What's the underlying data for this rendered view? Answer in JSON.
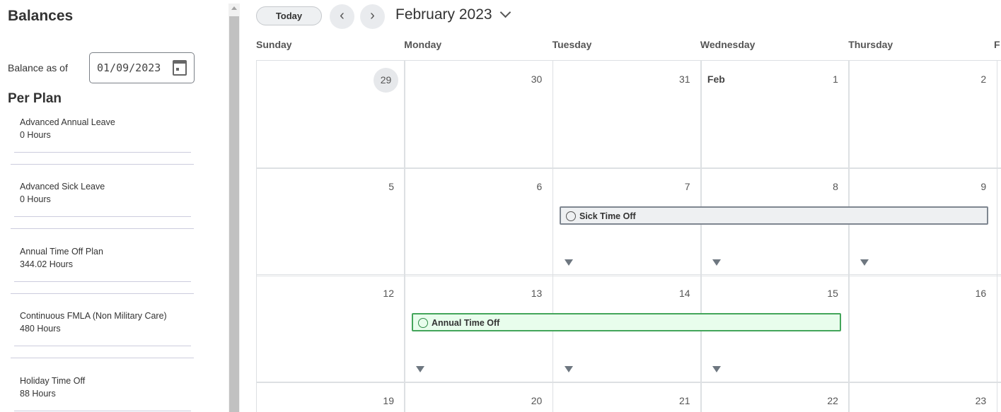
{
  "balances": {
    "title": "Balances",
    "balance_as_of_label": "Balance as of",
    "date_value": "01/09/2023",
    "per_plan_title": "Per Plan",
    "plans": [
      {
        "name": "Advanced Annual Leave",
        "hours": "0 Hours"
      },
      {
        "name": "Advanced Sick Leave",
        "hours": "0 Hours"
      },
      {
        "name": "Annual Time Off Plan",
        "hours": "344.02 Hours"
      },
      {
        "name": "Continuous FMLA (Non Military Care)",
        "hours": "480 Hours"
      },
      {
        "name": "Holiday Time Off",
        "hours": "88 Hours"
      }
    ]
  },
  "calendar": {
    "today_label": "Today",
    "month_label": "February 2023",
    "weekdays": [
      "Sunday",
      "Monday",
      "Tuesday",
      "Wednesday",
      "Thursday",
      "F"
    ],
    "weeks": [
      [
        "29",
        "30",
        "31",
        "1",
        "2"
      ],
      [
        "5",
        "6",
        "7",
        "8",
        "9"
      ],
      [
        "12",
        "13",
        "14",
        "15",
        "16"
      ],
      [
        "19",
        "20",
        "21",
        "22",
        "23"
      ]
    ],
    "feb_label": "Feb",
    "events": [
      {
        "label": "Sick Time Off",
        "icon": "clock-icon",
        "color": "#eef0f2"
      },
      {
        "label": "Annual Time Off",
        "icon": "check-circle-icon",
        "color": "#e8fdec"
      }
    ]
  }
}
